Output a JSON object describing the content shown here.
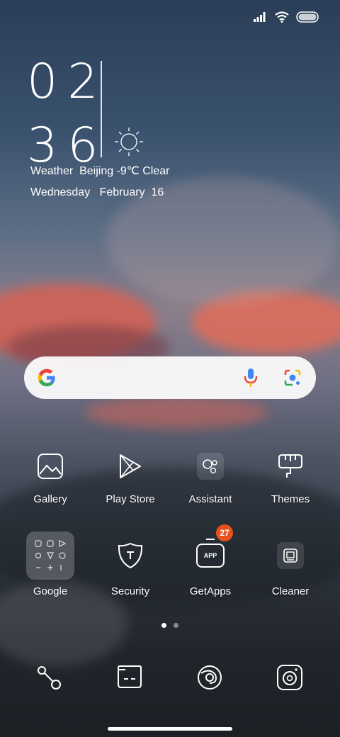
{
  "status_bar": {
    "icons": [
      "signal-icon",
      "wifi-icon",
      "battery-icon"
    ]
  },
  "clock": {
    "hours": "02",
    "minutes": "36"
  },
  "weather": {
    "label": "Weather",
    "city": "Beijing",
    "temp": "-9℃",
    "condition": "Clear",
    "icon": "sun-icon"
  },
  "date": {
    "weekday": "Wednesday",
    "month": "February",
    "day": "16"
  },
  "search": {
    "icons": [
      "google-g-icon",
      "microphone-icon",
      "lens-camera-icon"
    ]
  },
  "apps_row1": [
    {
      "label": "Gallery",
      "icon": "gallery-icon"
    },
    {
      "label": "Play Store",
      "icon": "play-store-icon"
    },
    {
      "label": "Assistant",
      "icon": "assistant-icon"
    },
    {
      "label": "Themes",
      "icon": "themes-icon"
    }
  ],
  "apps_row2": [
    {
      "label": "Google",
      "icon": "google-folder-icon"
    },
    {
      "label": "Security",
      "icon": "security-icon"
    },
    {
      "label": "GetApps",
      "icon": "getapps-icon",
      "badge": "27"
    },
    {
      "label": "Cleaner",
      "icon": "cleaner-icon"
    }
  ],
  "getapps_icon_text": "APP",
  "dock": [
    {
      "icon": "phone-icon"
    },
    {
      "icon": "messages-icon"
    },
    {
      "icon": "browser-icon"
    },
    {
      "icon": "camera-icon"
    }
  ],
  "page_indicator": {
    "count": 2,
    "active": 1
  },
  "colors": {
    "badge": "#e9511c",
    "cloud": "#e56f5a"
  }
}
